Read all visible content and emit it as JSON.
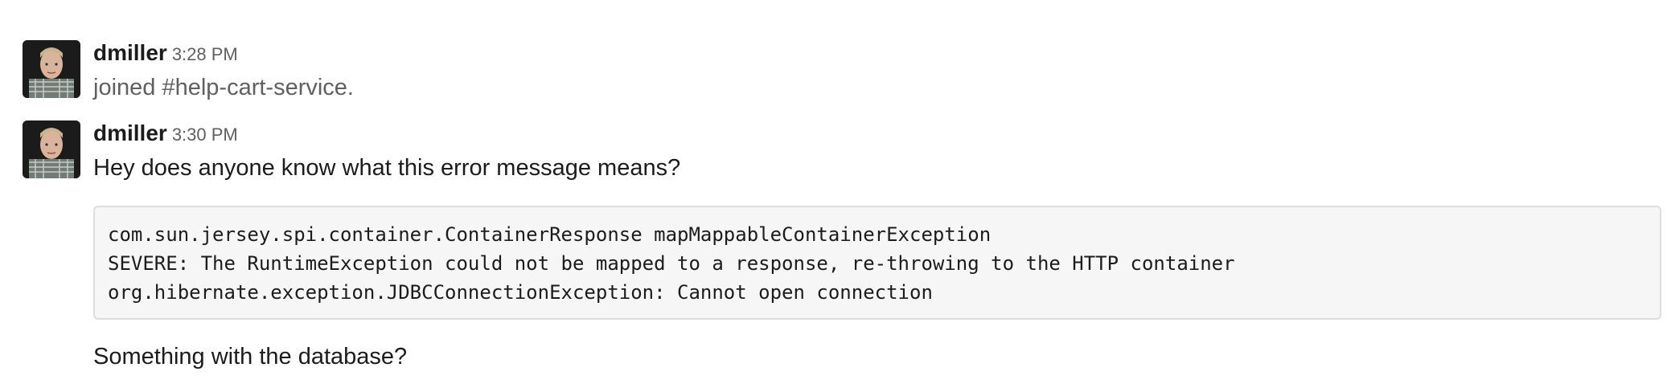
{
  "messages": [
    {
      "username": "dmiller",
      "timestamp": "3:28 PM",
      "text": "joined #help-cart-service."
    },
    {
      "username": "dmiller",
      "timestamp": "3:30 PM",
      "text": "Hey does anyone know what this error message means?",
      "code_lines": [
        "com.sun.jersey.spi.container.ContainerResponse mapMappableContainerException",
        "SEVERE: The RuntimeException could not be mapped to a response, re-throwing to the HTTP container",
        "org.hibernate.exception.JDBCConnectionException: Cannot open connection"
      ],
      "followup": "Something with the database?"
    }
  ]
}
